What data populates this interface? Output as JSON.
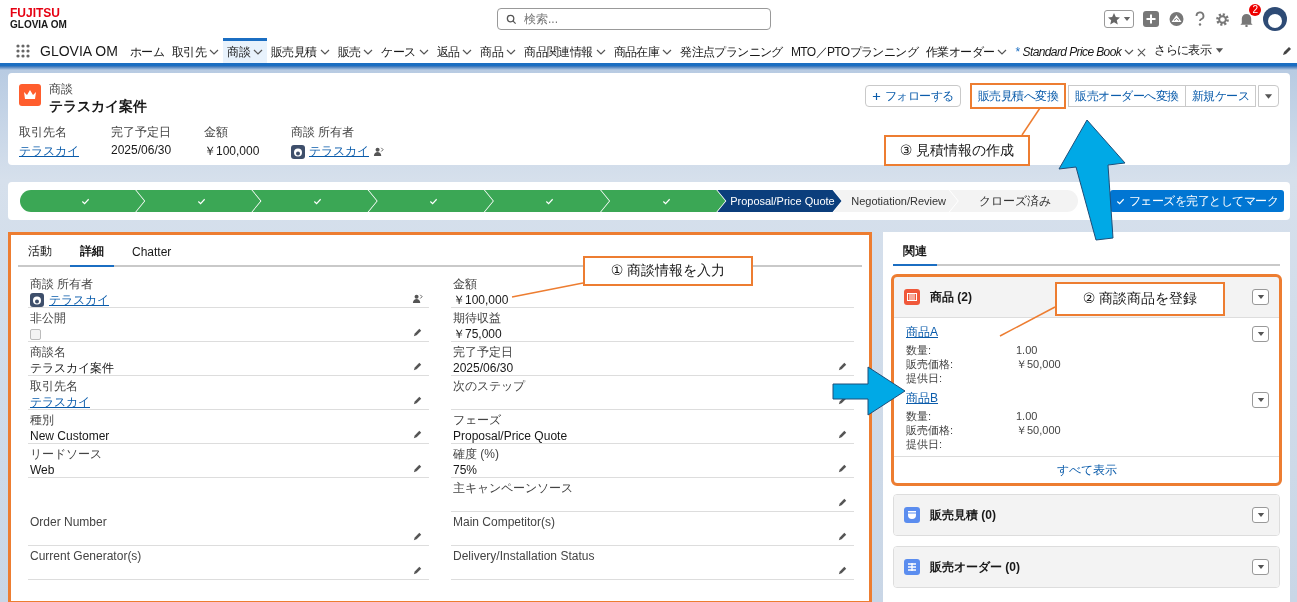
{
  "top_bar": {
    "brand": "FUJITSU",
    "product": "GLOVIA OM",
    "search": {
      "placeholder": "検索..."
    },
    "notification_count": "2"
  },
  "nav": {
    "app_name": "GLOVIA OM",
    "items": [
      {
        "label": "ホーム",
        "kind": "menu",
        "dropdown": false,
        "selected": false
      },
      {
        "label": "取引先",
        "kind": "menu",
        "dropdown": true,
        "selected": false
      },
      {
        "label": "商談",
        "kind": "menu",
        "dropdown": true,
        "selected": true
      },
      {
        "label": "販売見積",
        "kind": "menu",
        "dropdown": true,
        "selected": false
      },
      {
        "label": "販売",
        "kind": "menu",
        "dropdown": true,
        "selected": false
      },
      {
        "label": "ケース",
        "kind": "menu",
        "dropdown": true,
        "selected": false
      },
      {
        "label": "返品",
        "kind": "menu",
        "dropdown": true,
        "selected": false
      },
      {
        "label": "商品",
        "kind": "menu",
        "dropdown": true,
        "selected": false
      },
      {
        "label": "商品関連情報",
        "kind": "menu",
        "dropdown": true,
        "selected": false
      },
      {
        "label": "商品在庫",
        "kind": "menu",
        "dropdown": true,
        "selected": false
      },
      {
        "label": "発注点プランニング",
        "kind": "menu",
        "dropdown": false,
        "selected": false
      },
      {
        "label": "MTO／PTOプランニング",
        "kind": "menu",
        "dropdown": false,
        "selected": false
      },
      {
        "label": "作業オーダー",
        "kind": "menu",
        "dropdown": true,
        "selected": false
      },
      {
        "label": "Standard Price Book",
        "kind": "workspace_tab",
        "marker": "*",
        "dropdown": true,
        "selected": false
      }
    ],
    "more": "さらに表示"
  },
  "record": {
    "object_label": "商談",
    "title": "テラスカイ案件",
    "actions": [
      {
        "label": "フォローする",
        "kind": "follow",
        "highlighted": false
      },
      {
        "label": "販売見積へ変換",
        "kind": "action",
        "highlighted": true
      },
      {
        "label": "販売オーダーへ変換",
        "kind": "action",
        "highlighted": false
      },
      {
        "label": "新規ケース",
        "kind": "action",
        "highlighted": false
      }
    ],
    "fields": [
      {
        "label": "取引先名",
        "value": "テラスカイ",
        "kind": "link"
      },
      {
        "label": "完了予定日",
        "value": "2025/06/30",
        "kind": "text"
      },
      {
        "label": "金額",
        "value": "￥100,000",
        "kind": "text"
      },
      {
        "label": "商談 所有者",
        "value": "テラスカイ",
        "kind": "owner"
      }
    ]
  },
  "path": {
    "steps": [
      {
        "complete": true,
        "selected": false
      },
      {
        "complete": true,
        "selected": false
      },
      {
        "complete": true,
        "selected": false
      },
      {
        "complete": true,
        "selected": false
      },
      {
        "complete": true,
        "selected": false
      },
      {
        "complete": true,
        "selected": false
      },
      {
        "label": "Proposal/Price Quote",
        "complete": false,
        "selected": true
      },
      {
        "label": "Negotiation/Review",
        "complete": false,
        "selected": false
      },
      {
        "label": "クローズ済み",
        "complete": false,
        "selected": false
      }
    ],
    "mark_button": "フェーズを完了としてマーク"
  },
  "detail": {
    "highlighted": true,
    "tabs": [
      {
        "label": "活動",
        "selected": false
      },
      {
        "label": "詳細",
        "selected": true
      },
      {
        "label": "Chatter",
        "selected": false
      }
    ],
    "rows": [
      {
        "left": {
          "label": "商談 所有者",
          "value": "テラスカイ",
          "kind": "owner",
          "editable": false
        },
        "right": {
          "label": "金額",
          "value": "￥100,000",
          "kind": "text",
          "editable": false
        }
      },
      {
        "left": {
          "label": "非公開",
          "kind": "checkbox",
          "checked": false,
          "editable": true
        },
        "right": {
          "label": "期待収益",
          "value": "￥75,000",
          "kind": "text",
          "editable": false
        }
      },
      {
        "left": {
          "label": "商談名",
          "value": "テラスカイ案件",
          "kind": "text",
          "editable": true
        },
        "right": {
          "label": "完了予定日",
          "value": "2025/06/30",
          "kind": "text",
          "editable": true
        }
      },
      {
        "left": {
          "label": "取引先名",
          "value": "テラスカイ",
          "kind": "link",
          "editable": true
        },
        "right": {
          "label": "次のステップ",
          "kind": "text",
          "editable": true
        }
      },
      {
        "left": {
          "label": "種別",
          "value": "New Customer",
          "kind": "text",
          "editable": true
        },
        "right": {
          "label": "フェーズ",
          "value": "Proposal/Price Quote",
          "kind": "text",
          "editable": true
        }
      },
      {
        "left": {
          "label": "リードソース",
          "value": "Web",
          "kind": "text",
          "editable": true
        },
        "right": {
          "label": "確度 (%)",
          "value": "75%",
          "kind": "text",
          "editable": true
        }
      },
      {
        "right": {
          "label": "主キャンペーンソース",
          "kind": "text",
          "editable": true
        }
      },
      {
        "left": {
          "label": "Order Number",
          "kind": "text",
          "editable": true
        },
        "right": {
          "label": "Main Competitor(s)",
          "kind": "text",
          "editable": true
        }
      },
      {
        "left": {
          "label": "Current Generator(s)",
          "kind": "text",
          "editable": true
        },
        "right": {
          "label": "Delivery/Installation Status",
          "kind": "text",
          "editable": true
        }
      }
    ]
  },
  "related": {
    "tab": {
      "label": "関連",
      "selected": true
    },
    "lists": [
      {
        "title": "商品 (2)",
        "highlighted": true,
        "items": [
          {
            "name": "商品A",
            "fields": [
              {
                "label": "数量:",
                "value": "1.00"
              },
              {
                "label": "販売価格:",
                "value": "￥50,000"
              },
              {
                "label": "提供日:"
              }
            ]
          },
          {
            "name": "商品B",
            "fields": [
              {
                "label": "数量:",
                "value": "1.00"
              },
              {
                "label": "販売価格:",
                "value": "￥50,000"
              },
              {
                "label": "提供日:"
              }
            ]
          }
        ],
        "view_all": "すべて表示"
      },
      {
        "title": "販売見積 (0)",
        "highlighted": false
      },
      {
        "title": "販売オーダー (0)",
        "highlighted": false
      }
    ]
  },
  "annotations": [
    {
      "text": "③ 見積情報の作成"
    },
    {
      "text": "① 商談情報を入力"
    },
    {
      "text": "② 商談商品を登録"
    }
  ]
}
